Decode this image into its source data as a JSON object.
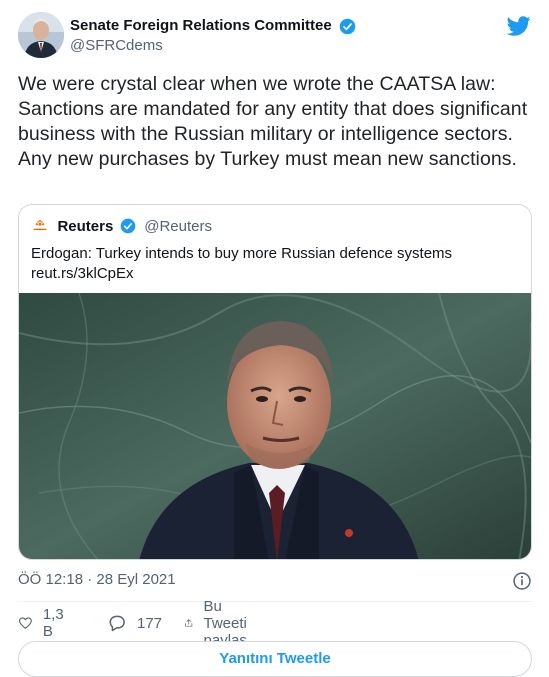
{
  "author": {
    "name": "Senate Foreign Relations Committee",
    "handle": "@SFRCdems",
    "verified": true
  },
  "tweet": {
    "text": "We were crystal clear when we wrote the CAATSA law: Sanctions are mandated for any entity that does significant business with the Russian military or intelligence sectors. Any new purchases by Turkey must mean new sanctions."
  },
  "quote": {
    "name": "Reuters",
    "handle": "@Reuters",
    "verified": true,
    "text": "Erdogan: Turkey intends to buy more Russian defence systems",
    "link": "reut.rs/3klCpEx"
  },
  "meta": {
    "timestamp": "ÖÖ 12:18 · 28 Eyl 2021"
  },
  "actions": {
    "likes": "1,3 B",
    "replies": "177",
    "share_label": "Bu Tweeti paylaş"
  },
  "reply_button": {
    "label": "Yanıtını Tweetle"
  },
  "colors": {
    "accent": "#1d9bf0",
    "secondary_text": "#536471",
    "border": "#cfd9de"
  },
  "icons": [
    "twitter-bird-icon",
    "verified-badge-icon",
    "reuters-logo-icon",
    "info-icon",
    "heart-icon",
    "reply-bubble-icon",
    "share-icon"
  ]
}
